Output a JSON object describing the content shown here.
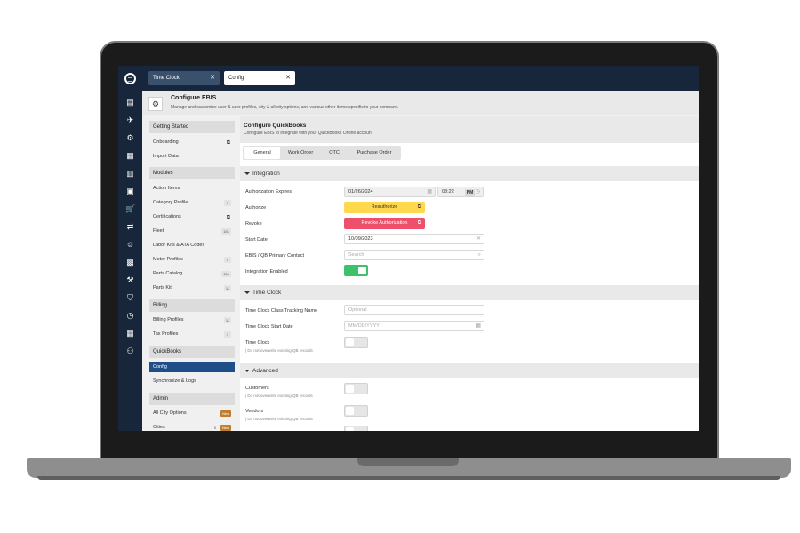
{
  "tabs": [
    {
      "label": "Time Clock",
      "active": false
    },
    {
      "label": "Config",
      "active": true
    }
  ],
  "header": {
    "title": "Configure EBIS",
    "subtitle": "Manage and customize user & user profiles, city & all city options, and various other items specific to your company."
  },
  "sidebar": {
    "sections": [
      {
        "label": "Getting Started",
        "items": [
          {
            "label": "Onboarding",
            "badge": "",
            "external": true
          },
          {
            "label": "Import Data",
            "badge": "",
            "external": false
          }
        ]
      },
      {
        "label": "Modules",
        "items": [
          {
            "label": "Action Items",
            "badge": "",
            "external": false
          },
          {
            "label": "Category Profile",
            "badge": "3",
            "external": false
          },
          {
            "label": "Certifications",
            "badge": "",
            "external": true
          },
          {
            "label": "Fleet",
            "badge": "151",
            "external": false
          },
          {
            "label": "Labor Kits & ATA Codes",
            "badge": "",
            "external": false
          },
          {
            "label": "Meter Profiles",
            "badge": "4",
            "external": false
          },
          {
            "label": "Parts Catalog",
            "badge": "151",
            "external": false
          },
          {
            "label": "Parts Kit",
            "badge": "11",
            "external": false
          }
        ]
      },
      {
        "label": "Billing",
        "items": [
          {
            "label": "Billing Profiles",
            "badge": "11",
            "external": false
          },
          {
            "label": "Tax Profiles",
            "badge": "1",
            "external": false
          }
        ]
      },
      {
        "label": "QuickBooks",
        "items": [
          {
            "label": "Config",
            "badge": "",
            "external": false,
            "active": true
          },
          {
            "label": "Synchronize & Logs",
            "badge": "",
            "external": false
          }
        ]
      },
      {
        "label": "Admin",
        "items": [
          {
            "label": "All City Options",
            "badge": "New",
            "external": false
          },
          {
            "label": "Cities",
            "badge": "0",
            "badge2": "New",
            "external": false
          }
        ]
      }
    ]
  },
  "main": {
    "title": "Configure QuickBooks",
    "subtitle": "Configure EBIS to integrate with your QuickBooks Online account",
    "subtabs": [
      "General",
      "Work Order",
      "OTC",
      "Purchase Order"
    ],
    "integration": {
      "heading": "Integration",
      "auth_expires_label": "Authorization Expires",
      "auth_expires_date": "01/26/2024",
      "auth_expires_time": "08:22",
      "auth_expires_ampm": "PM",
      "authorize_label": "Authorize",
      "reauthorize_button": "Reauthorize",
      "revoke_label": "Revoke",
      "revoke_button": "Revoke Authorization",
      "start_date_label": "Start Date",
      "start_date_value": "10/09/2023",
      "primary_contact_label": "EBIS / QB Primary Contact",
      "primary_contact_placeholder": "Search",
      "integration_enabled_label": "Integration Enabled",
      "integration_enabled": true
    },
    "time_clock": {
      "heading": "Time Clock",
      "class_tracking_label": "Time Clock Class Tracking Name",
      "class_tracking_placeholder": "Optional",
      "start_date_label": "Time Clock Start Date",
      "start_date_placeholder": "MM/DD/YYYY",
      "time_clock_label": "Time Clock",
      "time_clock_note": "Do not overwrite existing QB records",
      "time_clock_enabled": false
    },
    "advanced": {
      "heading": "Advanced",
      "customers_label": "Customers",
      "customers_note": "Do not overwrite existing QB records",
      "vendors_label": "Vendors",
      "vendors_note": "Do not overwrite existing QB records"
    }
  },
  "colors": {
    "rail": "#17263a",
    "accent_active": "#1f4e89",
    "reauthorize": "#ffd84d",
    "revoke": "#ee4f6a",
    "toggle_on": "#3dc26b"
  }
}
